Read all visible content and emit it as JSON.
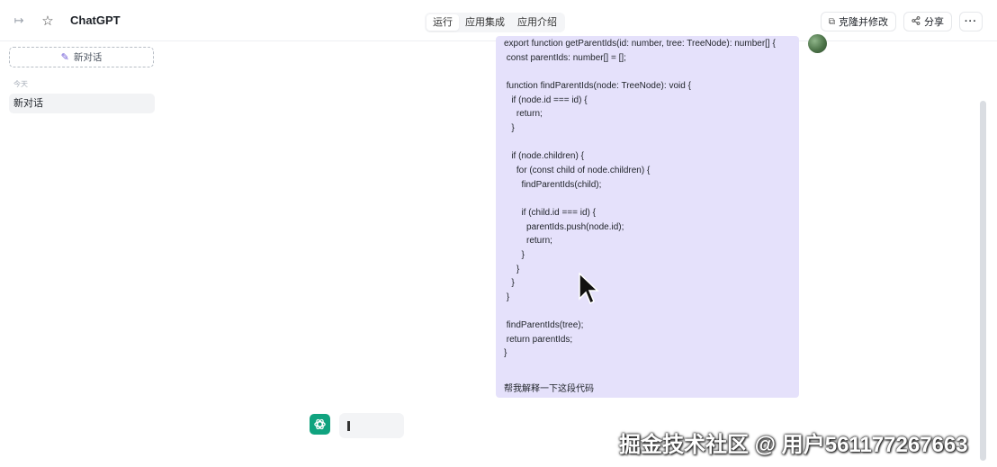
{
  "header": {
    "app_title": "ChatGPT",
    "tabs": [
      {
        "label": "运行",
        "active": true
      },
      {
        "label": "应用集成",
        "active": false
      },
      {
        "label": "应用介绍",
        "active": false
      }
    ],
    "clone_label": "克隆并修改",
    "share_label": "分享",
    "more_label": "···"
  },
  "sidebar": {
    "new_chat_label": "新对话",
    "group_label": "今天",
    "conversations": [
      {
        "label": "新对话"
      }
    ]
  },
  "chat": {
    "code": "export function getParentIds(id: number, tree: TreeNode): number[] {\n const parentIds: number[] = [];\n\n function findParentIds(node: TreeNode): void {\n   if (node.id === id) {\n     return;\n   }\n\n   if (node.children) {\n     for (const child of node.children) {\n       findParentIds(child);\n\n       if (child.id === id) {\n         parentIds.push(node.id);\n         return;\n       }\n     }\n   }\n }\n\n findParentIds(tree);\n return parentIds;\n}",
    "prompt": "帮我解释一下这段代码"
  },
  "watermark": "掘金技术社区 @ 用户561177267663",
  "colors": {
    "user_bubble": "#e5e1fb",
    "bot_icon": "#10a37f",
    "accent": "#6b56d6"
  },
  "icons": {
    "collapse": "collapse-sidebar-icon",
    "favorite": "star-icon",
    "clone": "copy-icon",
    "share": "share-icon",
    "edit": "edit-icon",
    "bot": "openai-logo-icon"
  }
}
